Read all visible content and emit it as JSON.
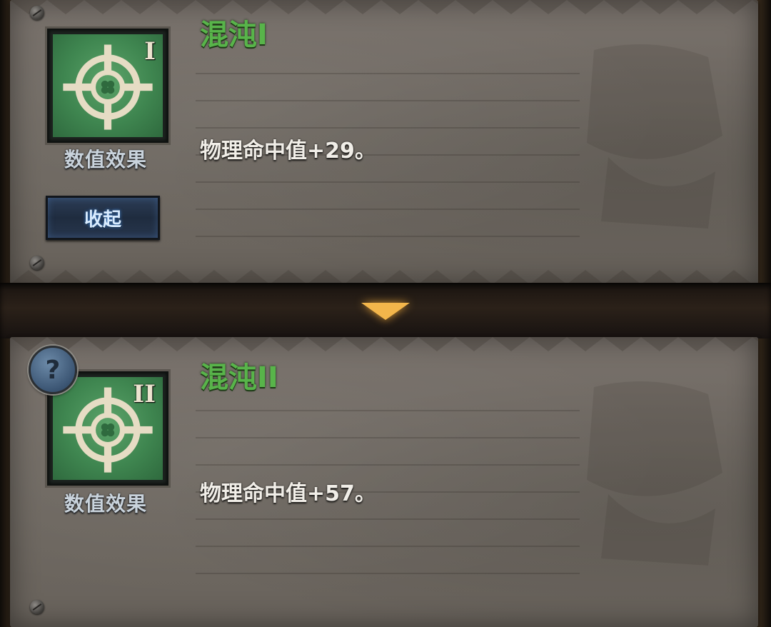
{
  "entries": [
    {
      "title": "混沌I",
      "level_roman": "I",
      "icon": "crosshair-clover-icon",
      "category": "数值效果",
      "description": "物理命中值+29。",
      "collapse_label": "收起"
    },
    {
      "title": "混沌II",
      "level_roman": "II",
      "icon": "crosshair-clover-icon",
      "category": "数值效果",
      "description": "物理命中值+57。",
      "help_label": "?"
    }
  ],
  "colors": {
    "title_green": "#58b44a",
    "icon_green": "#3f8650",
    "arrow_gold": "#f3b64b",
    "button_blue": "#2c3d56"
  }
}
